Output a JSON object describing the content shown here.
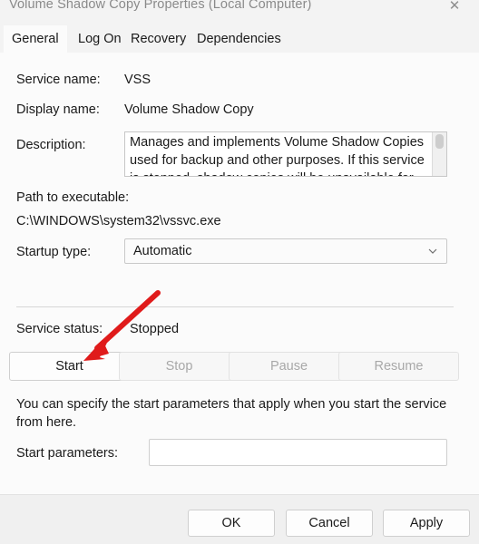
{
  "window": {
    "title": "Volume Shadow Copy Properties (Local Computer)",
    "close_label": "✕"
  },
  "tabs": [
    {
      "label": "General",
      "active": true
    },
    {
      "label": "Log On",
      "active": false
    },
    {
      "label": "Recovery",
      "active": false
    },
    {
      "label": "Dependencies",
      "active": false
    }
  ],
  "general": {
    "service_name_label": "Service name:",
    "service_name_value": "VSS",
    "display_name_label": "Display name:",
    "display_name_value": "Volume Shadow Copy",
    "description_label": "Description:",
    "description_value": "Manages and implements Volume Shadow Copies used for backup and other purposes. If this service is stopped, shadow copies will be unavailable for",
    "path_label": "Path to executable:",
    "path_value": "C:\\WINDOWS\\system32\\vssvc.exe",
    "startup_type_label": "Startup type:",
    "startup_type_value": "Automatic",
    "service_status_label": "Service status:",
    "service_status_value": "Stopped"
  },
  "service_buttons": [
    {
      "label": "Start",
      "enabled": true
    },
    {
      "label": "Stop",
      "enabled": false
    },
    {
      "label": "Pause",
      "enabled": false
    },
    {
      "label": "Resume",
      "enabled": false
    }
  ],
  "start_parameters": {
    "help_text": "You can specify the start parameters that apply when you start the service from here.",
    "label": "Start parameters:",
    "value": "",
    "placeholder": ""
  },
  "footer_buttons": [
    {
      "label": "OK"
    },
    {
      "label": "Cancel"
    },
    {
      "label": "Apply"
    }
  ],
  "annotation": {
    "arrow_color": "#e01b1b",
    "target": "start-button"
  },
  "colors": {
    "dialog_background": "#f3f3f3",
    "content_background": "#fbfbfb",
    "text": "#1a1a1a",
    "disabled_text": "#a8a8a8",
    "border": "#cfcfcf",
    "accent_red": "#e01b1b"
  }
}
